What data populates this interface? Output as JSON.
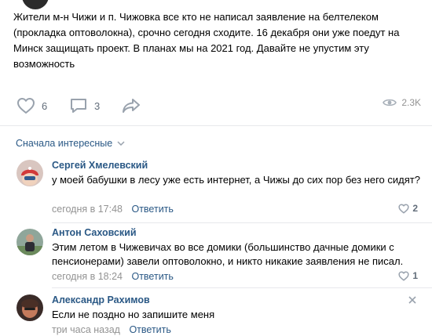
{
  "post": {
    "text": "Жители м-н Чижи и п. Чижовка все кто не написал заявление на белтелеком (прокладка оптоволокна), срочно сегодня сходите. 16 декабря они уже поедут на Минск защищать проект. В планах мы на 2021 год. Давайте не упустим эту возможность",
    "likes": "6",
    "comments": "3",
    "views": "2.3K"
  },
  "sort": {
    "label": "Сначала интересные"
  },
  "comments": [
    {
      "author": "Сергей Хмелевский",
      "text": "у моей бабушки в лесу уже есть интернет, а Чижы до сих пор без него сидят?",
      "time": "сегодня в 17:48",
      "reply": "Ответить",
      "likes": "2"
    },
    {
      "author": "Антон Саховский",
      "text": "Этим летом в Чижевичах во все домики (большинство дачные домики с пенсионерами) завели оптоволокно, и никто никакие заявления не писал.",
      "time": "сегодня в 18:24",
      "reply": "Ответить",
      "likes": "1"
    },
    {
      "author": "Александр Рахимов",
      "text": "Если не поздно но запишите меня",
      "time": "три часа назад",
      "reply": "Ответить",
      "likes": ""
    }
  ],
  "colors": {
    "link": "#2a5885",
    "muted": "#939393",
    "icon": "#99a2ad"
  },
  "icons": {
    "like": "heart-icon",
    "comment": "comment-bubble-icon",
    "share": "share-arrow-icon",
    "views": "eye-icon",
    "sort": "chevron-down-icon",
    "close": "close-icon"
  }
}
